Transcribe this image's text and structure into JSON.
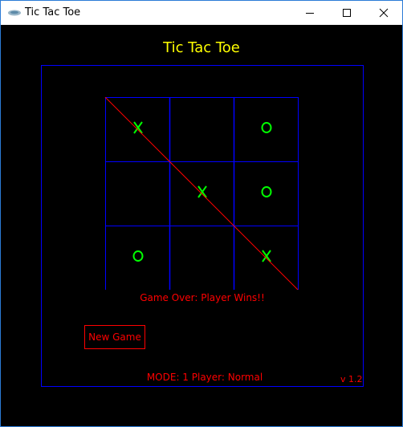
{
  "window": {
    "title": "Tic Tac Toe",
    "controls": {
      "minimize": "minimize-icon",
      "maximize": "maximize-icon",
      "close": "close-icon"
    },
    "border_color": "#2b7bd6"
  },
  "game": {
    "title": "Tic Tac Toe",
    "board": [
      [
        "X",
        "",
        "O"
      ],
      [
        "",
        "X",
        "O"
      ],
      [
        "O",
        "",
        "X"
      ]
    ],
    "winning_line": "main-diagonal",
    "status": "Game Over:  Player Wins!!",
    "new_game_label": "New Game",
    "mode": "MODE:  1 Player:  Normal",
    "version": "v 1.2"
  },
  "colors": {
    "title": "#ffff00",
    "grid": "#0000ff",
    "marks": "#00ff00",
    "accent": "#ff0000",
    "background": "#000000"
  }
}
